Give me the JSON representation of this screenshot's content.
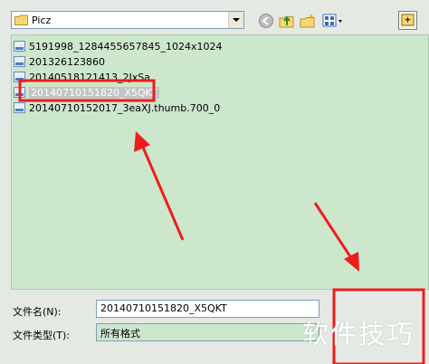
{
  "toolbar": {
    "path_value": "Picz",
    "icons": [
      "folder-icon",
      "back-icon",
      "up-folder-icon",
      "new-folder-icon",
      "view-menu-icon"
    ]
  },
  "files": [
    {
      "name": "5191998_1284455657845_1024x1024",
      "selected": false
    },
    {
      "name": "201326123860",
      "selected": false
    },
    {
      "name": "20140518121413_2JxSa",
      "selected": false
    },
    {
      "name": "20140710151820_X5QKT",
      "selected": true
    },
    {
      "name": "20140710152017_3eaXJ.thumb.700_0",
      "selected": false
    }
  ],
  "form": {
    "filename_label": "文件名(N):",
    "filename_value": "20140710151820_X5QKT",
    "filetype_label": "文件类型(T):",
    "filetype_value": "所有格式"
  },
  "watermark": "软件技巧",
  "colors": {
    "list_background": "#cde7cd",
    "annotation_red": "#ee1c1c",
    "selection_gray": "#c4c4c4"
  }
}
